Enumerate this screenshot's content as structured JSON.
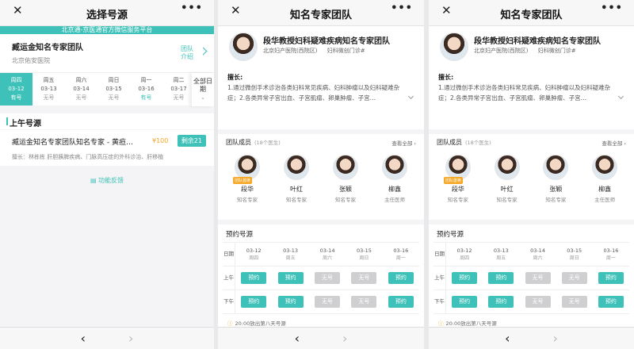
{
  "panel1": {
    "nav": {
      "close": "✕",
      "title": "选择号源",
      "more": "•••"
    },
    "banner": "北京通-京医通官方微信服务平台",
    "team": {
      "name": "臧运金知名专家团队",
      "hospital": "北京佑安医院",
      "intro_link": "团队介绍"
    },
    "dates": [
      {
        "weekday": "周四",
        "date": "03-12",
        "status": "有号",
        "selected": true,
        "available": true
      },
      {
        "weekday": "周五",
        "date": "03-13",
        "status": "无号",
        "selected": false,
        "available": false
      },
      {
        "weekday": "周六",
        "date": "03-14",
        "status": "无号",
        "selected": false,
        "available": false
      },
      {
        "weekday": "周日",
        "date": "03-15",
        "status": "无号",
        "selected": false,
        "available": false
      },
      {
        "weekday": "周一",
        "date": "03-16",
        "status": "有号",
        "selected": false,
        "available": true
      },
      {
        "weekday": "周二",
        "date": "03-17",
        "status": "无号",
        "selected": false,
        "available": false
      }
    ],
    "all_dates": "全部日期",
    "section": "上午号源",
    "slot": {
      "name": "臧运金知名专家团队知名专家 - 黄疸…",
      "price": "¥100",
      "remaining": "剩余21",
      "description": "擅长：林栋栋 肝胆胰脾疾病、门脉高压症的外科诊治、肝移植"
    },
    "feedback": "功能反馈",
    "bottom": {
      "back": "‹",
      "forward": "›"
    }
  },
  "doc": {
    "nav": {
      "close": "✕",
      "title": "知名专家团队",
      "more": "•••"
    },
    "title": "段华教授妇科疑难疾病知名专家团队",
    "hospital": "北京妇产医院(西院区)",
    "dept": "妇科微创门诊#",
    "spec_label": "擅长:",
    "spec_text": "1.通过微创手术诊治各类妇科常见疾病、妇科肿瘤以及妇科疑难杂症；2.各类异常子宫出血、子宫肌瘤、卵巢肿瘤、子宫…",
    "members_title": "团队成员",
    "members_count": "(18个医生)",
    "view_all": "查看全部 ›",
    "members": [
      {
        "name": "段华",
        "title": "知名专家",
        "tag": "团队首席"
      },
      {
        "name": "叶红",
        "title": "知名专家",
        "tag": ""
      },
      {
        "name": "张颖",
        "title": "知名专家",
        "tag": ""
      },
      {
        "name": "柳鑫",
        "title": "主任医师",
        "tag": ""
      }
    ],
    "schedule_title": "预约号源",
    "row_labels": {
      "date": "日期",
      "am": "上午",
      "pm": "下午"
    },
    "columns": [
      {
        "date": "03-12",
        "weekday": "周四",
        "am": "预约",
        "pm": "预约",
        "am_ok": true,
        "pm_ok": true
      },
      {
        "date": "03-13",
        "weekday": "周五",
        "am": "预约",
        "pm": "预约",
        "am_ok": true,
        "pm_ok": true
      },
      {
        "date": "03-14",
        "weekday": "周六",
        "am": "无号",
        "pm": "无号",
        "am_ok": false,
        "pm_ok": false
      },
      {
        "date": "03-15",
        "weekday": "周日",
        "am": "无号",
        "pm": "无号",
        "am_ok": false,
        "pm_ok": false
      },
      {
        "date": "03-16",
        "weekday": "周一",
        "am": "预约",
        "pm": "预约",
        "am_ok": true,
        "pm_ok": true
      }
    ],
    "notice": "20:00放出第八天号源",
    "bottom": {
      "back": "‹",
      "forward": "›"
    }
  },
  "colors": {
    "accent": "#3dc1b8",
    "price": "#f5a623",
    "disabled": "#cfcfd2"
  }
}
